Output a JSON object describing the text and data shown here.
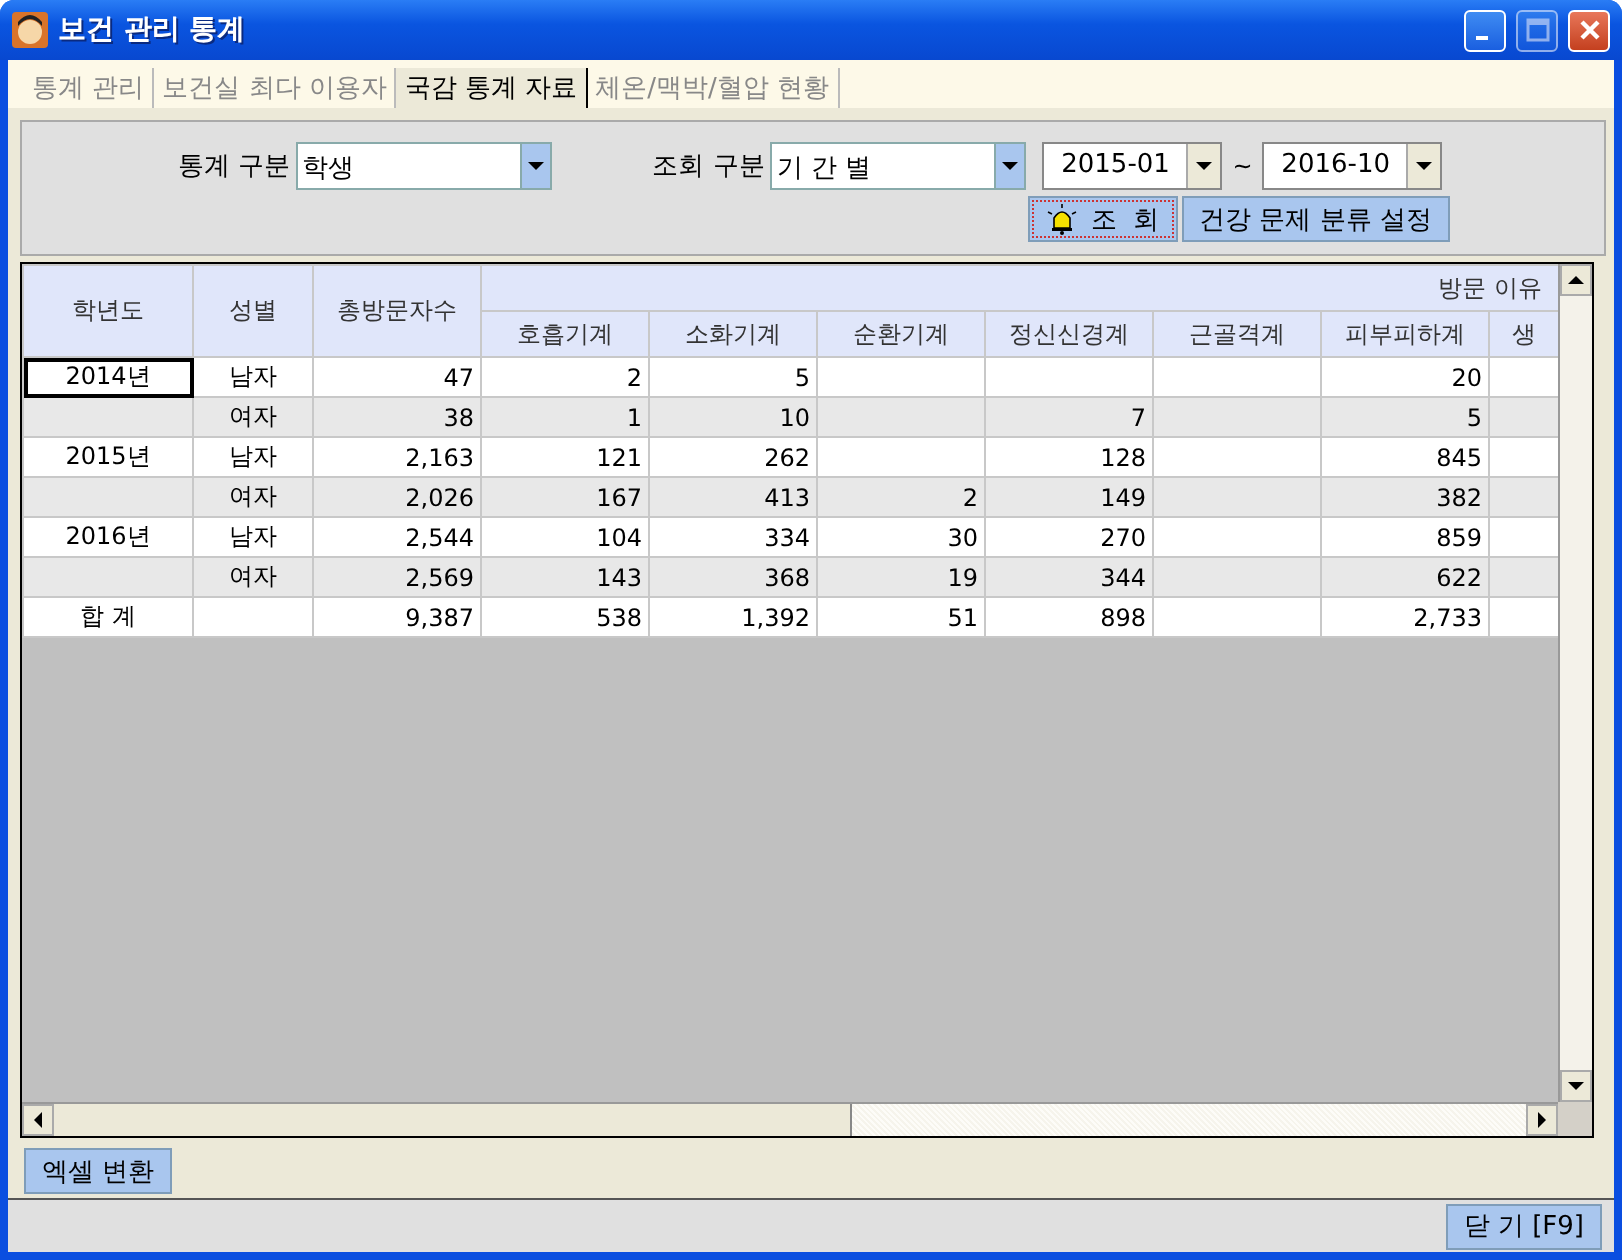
{
  "window": {
    "title": "보건 관리 통계"
  },
  "tabs": [
    {
      "label": "통계 관리",
      "selected": false
    },
    {
      "label": "보건실 최다 이용자",
      "selected": false
    },
    {
      "label": "국감 통계 자료",
      "selected": true
    },
    {
      "label": "체온/맥박/혈압 현황",
      "selected": false
    }
  ],
  "filters": {
    "stat_label": "통계 구분",
    "stat_value": "학생",
    "query_label": "조회 구분",
    "query_value": "기 간 별",
    "from": "2015-01",
    "range_sep": "~",
    "to": "2016-10"
  },
  "buttons": {
    "search": "조  회",
    "config": "건강 문제 분류 설정",
    "excel": "엑셀 변환",
    "close": "닫 기 [F9]"
  },
  "table": {
    "columns": [
      "학년도",
      "성별",
      "총방문자수"
    ],
    "group_header": "방문 이유",
    "sub_columns": [
      "호흡기계",
      "소화기계",
      "순환기계",
      "정신신경계",
      "근골격계",
      "피부피하계",
      "생"
    ],
    "rows": [
      {
        "year": "2014년",
        "gender": "남자",
        "total": "47",
        "values": {
          "col_1": "2",
          "col_2": "5",
          "col_6": "20"
        },
        "selected": true
      },
      {
        "gender": "여자",
        "total": "38",
        "values": {
          "col_1": "1",
          "col_2": "10",
          "col_4": "7",
          "col_6": "5"
        },
        "selected": false
      },
      {
        "year": "2015년",
        "gender": "남자",
        "total": "2,163",
        "values": {
          "col_1": "121",
          "col_2": "262",
          "col_4": "128",
          "col_6": "845"
        },
        "selected": false
      },
      {
        "gender": "여자",
        "total": "2,026",
        "values": {
          "col_1": "167",
          "col_2": "413",
          "col_3": "2",
          "col_4": "149",
          "col_6": "382"
        },
        "selected": false
      },
      {
        "year": "2016년",
        "gender": "남자",
        "total": "2,544",
        "values": {
          "col_1": "104",
          "col_2": "334",
          "col_3": "30",
          "col_4": "270",
          "col_6": "859"
        },
        "selected": false
      },
      {
        "gender": "여자",
        "total": "2,569",
        "values": {
          "col_1": "143",
          "col_2": "368",
          "col_3": "19",
          "col_4": "344",
          "col_6": "622"
        },
        "selected": false
      },
      {
        "year": "합 계",
        "total": "9,387",
        "values": {
          "col_1": "538",
          "col_2": "1,392",
          "col_3": "51",
          "col_4": "898",
          "col_6": "2,733"
        },
        "selected": false
      }
    ]
  }
}
